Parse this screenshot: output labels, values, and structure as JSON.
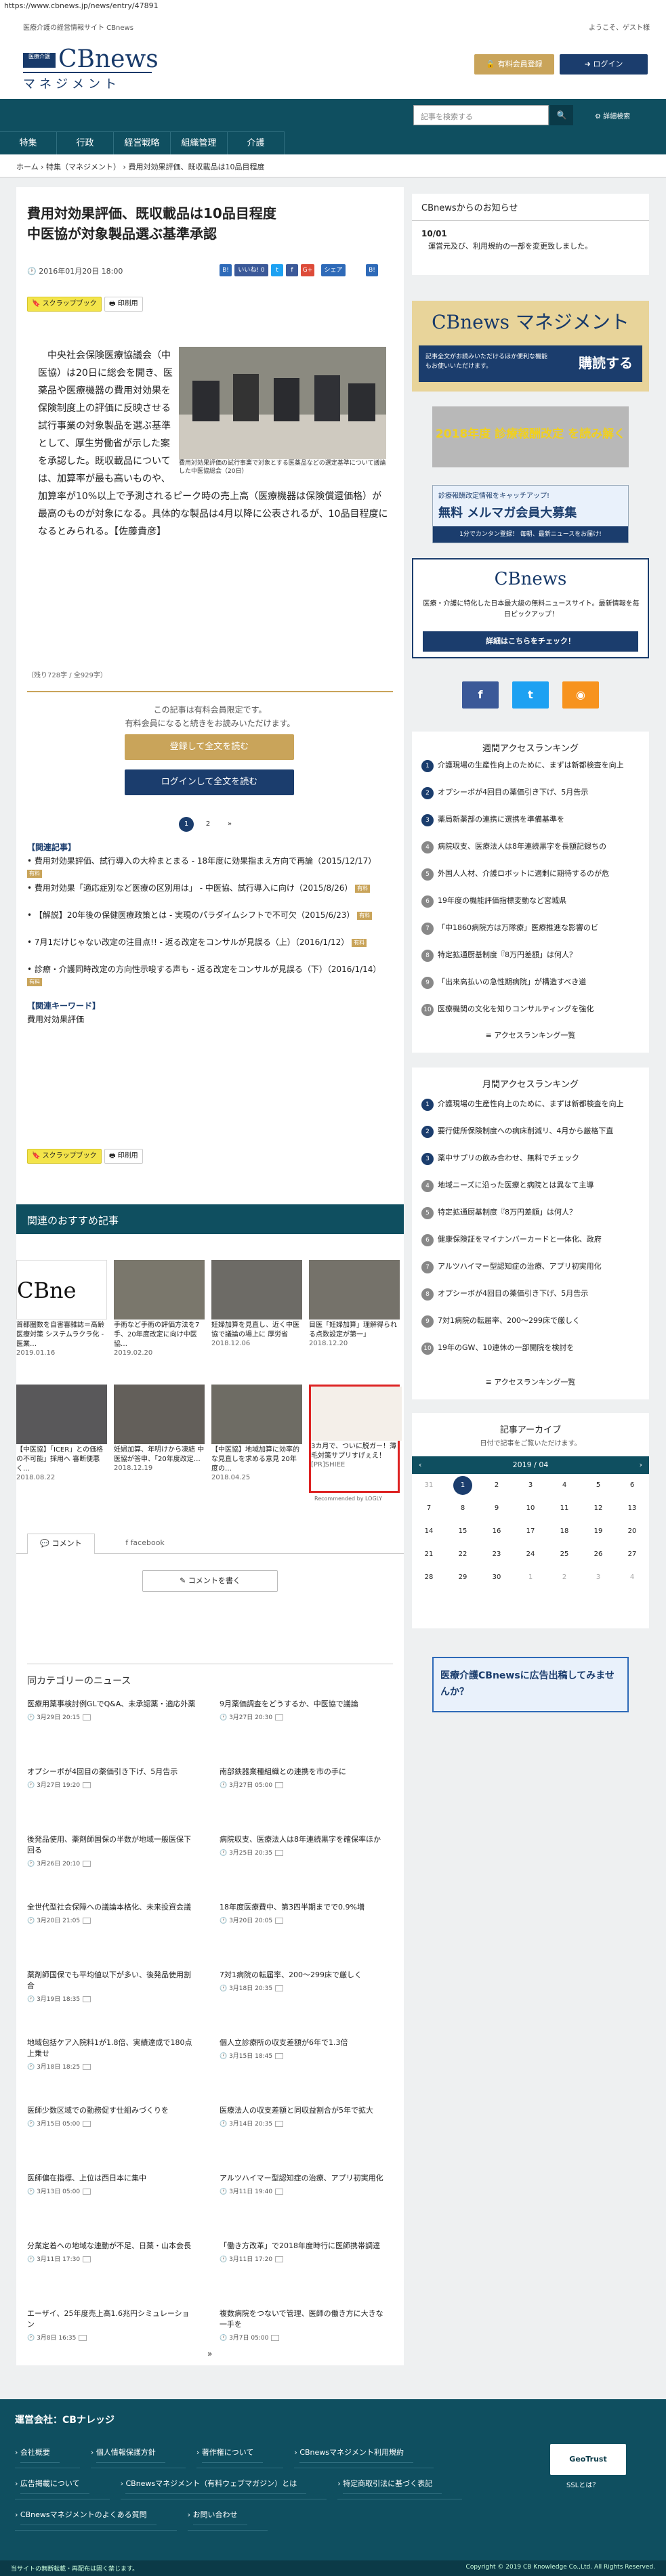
{
  "url": "https://www.cbnews.jp/news/entry/47891",
  "header": {
    "tagline": "医療介護の経営情報サイト CBnews",
    "welcome": "ようこそ、ゲスト様",
    "logo_box": "医療介護",
    "logo_cb": "CBnews",
    "logo_sub": "マネジメント",
    "btn_member": "有料会員登録",
    "btn_login": "ログイン"
  },
  "nav": {
    "search_placeholder": "記事を検索する",
    "advanced": "詳細検索",
    "items": [
      "特集",
      "行政",
      "経営戦略",
      "組織管理",
      "介護"
    ]
  },
  "breadcrumb": "ホーム › 特集（マネジメント） › 費用対効果評価、既収載品は10品目程度",
  "article": {
    "title": "費用対効果評価、既収載品は10品目程度\n中医協が対象製品選ぶ基準承認",
    "date": "2016年01月20日 18:00",
    "share": {
      "hatena": "B!",
      "like": "いいね! 0",
      "tweet": "t",
      "fb": "f",
      "google": "G+",
      "share": "シェア",
      "b": "B!"
    },
    "scrap": "スクラップブック",
    "print": "印刷用",
    "body": "中央社会保険医療協議会（中医協）は20日に総会を開き、医薬品や医療機器の費用対効果を保険制度上の評価に反映させる試行事業の対象製品を選ぶ基準として、厚生労働省が示した案を承認した。既収載品については、加算率が最も高いものや、加算率が10%以上で予測されるピーク時の売上高（医療機器は保険償還価格）が最高のものが対象になる。具体的な製品は4月以降に公表されるが、10品目程度になるとみられる。【佐藤貴彦】",
    "photo_caption": "費用対効果評価の試行事業で対象とする医薬品などの選定基準について議論した中医協総会（20日）",
    "chars": "（残り728字 / 全929字）",
    "lock1": "この記事は有料会員限定です。",
    "lock2": "有料会員になると続きをお読みいただけます。",
    "cta_register": "登録して全文を読む",
    "cta_login": "ログインして全文を読む",
    "pager": [
      "1",
      "2",
      "»"
    ],
    "related_heading": "【関連記事】",
    "related": [
      {
        "text": "費用対効果評価、試行導入の大枠まとまる - 18年度に効果指まえ方向で再論（2015/12/17）"
      },
      {
        "text": "費用対効果「適応症別など医療の区別用は」 - 中医協、試行導入に向け（2015/8/26）"
      },
      {
        "text": "【解説】20年後の保健医療政策とは - 実現のパラダイムシフトで不可欠（2015/6/23）"
      },
      {
        "text": "7月1だけじゃない改定の注目点!! - 返る改定をコンサルが見誤る（上）（2016/1/12）"
      },
      {
        "text": "診療・介護同時改定の方向性示唆する声も - 返る改定をコンサルが見誤る（下）（2016/1/14）"
      }
    ],
    "keywords_heading": "【関連キーワード】",
    "keyword": "費用対効果評価",
    "member": "有料"
  },
  "recommend": {
    "heading": "関連のおすすめ記事",
    "items": [
      {
        "title": "首都圏数を自害審雑誌＝高齢医療対策 システムラクラ化 - 医業…",
        "date": "2019.01.16"
      },
      {
        "title": "手術など手術の評価方法を7手、20年度改定に向け中医協…",
        "date": "2019.02.20"
      },
      {
        "title": "妊婦加算を見直し、近く中医協で議論の場上に 厚労省",
        "date": "2018.12.06"
      },
      {
        "title": "目医「妊婦加算」理解得られる点数設定が第一」",
        "date": "2018.12.20"
      },
      {
        "title": "【中医協】「ICER」との価格の不可能」採用へ 審断便悪く…",
        "date": "2018.08.22"
      },
      {
        "title": "妊婦加算、年明けから凍結 中医協が答申、「20年度改定…",
        "date": "2018.12.19"
      },
      {
        "title": "【中医協】地域加算に効率的な見直しを求める意見 20年度の…",
        "date": "2018.04.25"
      },
      {
        "title": "3カ月で、ついに脱ガー！薄毛対策サプリすげぇえ！",
        "date": "[PR]SHIEE"
      }
    ],
    "logly": "Recommended by LOGLY"
  },
  "comments": {
    "tab1": "コメント",
    "tab2": "facebook",
    "write": "コメントを書く"
  },
  "category": {
    "heading": "同カテゴリーのニュース",
    "items": [
      {
        "title": "医療用薬事検討例GLでQ&A、未承認薬・適応外薬",
        "date": "3月29日 20:15"
      },
      {
        "title": "9月薬価調査をどうするか、中医協で議論",
        "date": "3月27日 20:30"
      },
      {
        "title": "オプシーボが4回目の薬価引き下げ、5月告示",
        "date": "3月27日 19:20"
      },
      {
        "title": "南部鉄器業種組織との連携を市の手に",
        "date": "3月27日 05:00"
      },
      {
        "title": "後発品使用、薬剤師国保の半数が地域一般医保下回る",
        "date": "3月26日 20:10"
      },
      {
        "title": "病院収支、医療法人は8年連続黒字を確保率ほか",
        "date": "3月25日 20:35"
      },
      {
        "title": "全世代型社会保障への議論本格化、未来投資会議",
        "date": "3月20日 21:05"
      },
      {
        "title": "18年度医療費中、第3四半期までで0.9%増",
        "date": "3月20日 20:05"
      },
      {
        "title": "薬剤師国保でも平均値以下が多い、後発品使用割合",
        "date": "3月19日 18:35"
      },
      {
        "title": "7対1病院の転届率、200～299床で厳しく",
        "date": "3月18日 20:35"
      },
      {
        "title": "地域包括ケア入院料1が1.8倍、実績達成で180点上乗せ",
        "date": "3月18日 18:25"
      },
      {
        "title": "個人立診療所の収支差額が6年で1.3倍",
        "date": "3月15日 18:45"
      },
      {
        "title": "医師少数区域での勤務促す仕組みづくりを",
        "date": "3月15日 05:00"
      },
      {
        "title": "医療法人の収支差額と同収益割合が5年で拡大",
        "date": "3月14日 20:35"
      },
      {
        "title": "医師偏在指標、上位は西日本に集中",
        "date": "3月13日 05:00"
      },
      {
        "title": "アルツハイマー型認知症の治療、アプリ初実用化",
        "date": "3月11日 19:40"
      },
      {
        "title": "分業定着への地域な連動が不足、日薬・山本会長",
        "date": "3月11日 17:30"
      },
      {
        "title": "「働き方改革」で2018年度時行に医師携帯調達",
        "date": "3月11日 17:20"
      },
      {
        "title": "エーザイ、25年度売上高1.6兆円シミュレーション",
        "date": "3月8日 16:35"
      },
      {
        "title": "複数病院をつないで管理、医師の働き方に大きな一手を",
        "date": "3月7日 05:00"
      }
    ]
  },
  "sidebar": {
    "notice_heading": "CBnewsからのお知らせ",
    "notice_date": "10/01",
    "notice_text": "運営元及び、利用規約の一部を変更致しました。",
    "ad1_title": "CBnews マネジメント",
    "ad1_desc": "記事全文がお読みいただけるほか便利な機能もお使いいただけます。",
    "ad1_cta": "購読する",
    "ad2_text": "2018年度 診療報酬改定 を読み解く",
    "ad3_title": "無料 メルマガ会員大募集",
    "ad3_sub": "診療報酬改定情報をキャッチアップ!",
    "ad3_small": "1分でカンタン登録！ 毎朝、最新ニュースをお届け!",
    "promo_logo": "CBnews",
    "promo_text": "医療・介護に特化した日本最大級の無料ニュースサイト。最新情報を毎日ピックアップ！",
    "promo_btn": "詳細はこちらをチェック！",
    "weekly_heading": "週間アクセスランキング",
    "weekly": [
      "介護現場の生産性向上のために、まずは新都検査を向上",
      "オプシーボが4回目の薬価引き下げ、5月告示",
      "薬局新薬部の連携に選携を準備基準を",
      "病院収支、医療法人は8年連続黒字を長額記録ちの",
      "外国人人材、介護ロボットに適剰に期待するのが危",
      "19年度の機能評価指標変動など宮城県",
      "「中1860病院方は万隊療」医療推進な影響のビ",
      "特定拡通厨基制度『8万円差額」は何人？",
      "「出来高払いの急性期病院」が構造すべき道",
      "医療機関の文化を知りコンサルティングを強化"
    ],
    "monthly_heading": "月間アクセスランキング",
    "monthly": [
      "介護現場の生産性向上のために、まずは新都検査を向上",
      "要行健所保険制度への病床削減リ、4月から厳格下直",
      "薬中サプリの飲み合わせ、無料でチェック",
      "地域ニーズに沿った医療と病院とは異なて主導",
      "特定拡通厨基制度『8万円差額」は何人？",
      "健康保険証をマイナンバーカードと一体化、政府",
      "アルツハイマー型認知症の治療、アプリ初実用化",
      "オプシーボが4回目の薬価引き下げ、5月告示",
      "7対1病院の転届率、200～299床で厳しく",
      "19年のGW、10連休の一部開院を検討を"
    ],
    "rank_more": "アクセスランキング一覧",
    "archive_heading": "記事アーカイブ",
    "archive_sub": "日付で記事をご覧いただけます。",
    "cal_month": "2019 / 04",
    "cal_days": [
      "31",
      "1",
      "2",
      "3",
      "4",
      "5",
      "6",
      "7",
      "8",
      "9",
      "10",
      "11",
      "12",
      "13",
      "14",
      "15",
      "16",
      "17",
      "18",
      "19",
      "20",
      "21",
      "22",
      "23",
      "24",
      "25",
      "26",
      "27",
      "28",
      "29",
      "30",
      "1",
      "2",
      "3",
      "4"
    ],
    "ad_bottom": "医療介護CBnewsに広告出稿してみませんか？"
  },
  "footer": {
    "heading": "運営会社：CBナレッジ",
    "links": [
      "会社概要",
      "個人情報保護方針",
      "著作権について",
      "CBnewsマネジメント利用規約",
      "広告掲載について",
      "CBnewsマネジメント（有料ウェブマガジン）とは",
      "特定商取引法に基づく表記",
      "CBnewsマネジメントのよくある質問",
      "お問い合わせ"
    ],
    "ssl": "SSLとは？",
    "geotrust": "GeoTrust",
    "copyright": "Copyright © 2019 CB Knowledge Co.,Ltd. All Rights Reserved.",
    "notice": "当サイトの無断転載・再配布は固く禁じます。"
  }
}
